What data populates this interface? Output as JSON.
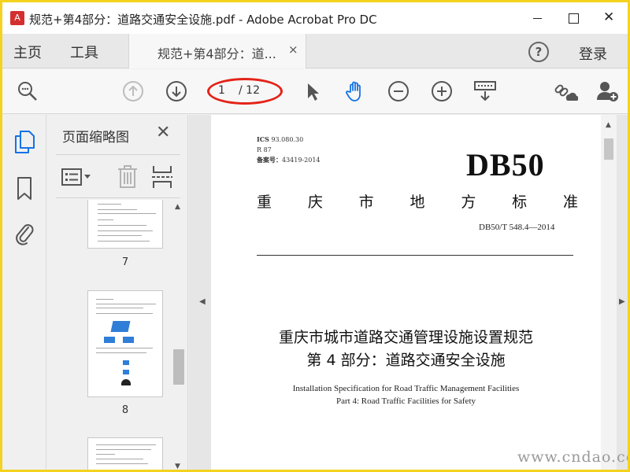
{
  "window": {
    "title": "规范+第4部分：道路交通安全设施.pdf - Adobe Acrobat Pro DC",
    "min_icon": "minimize-icon",
    "max_icon": "maximize-icon",
    "close_glyph": "✕"
  },
  "menu": {
    "home": "主页",
    "tools": "工具",
    "doc_tab": "规范+第4部分：道...",
    "doc_tab_close": "×",
    "help_glyph": "?",
    "login": "登录"
  },
  "toolbar": {
    "zoom_icon": "search-zoom-icon",
    "prev_icon": "arrow-up-circle-icon",
    "next_icon": "arrow-down-circle-icon",
    "page_current": "1",
    "page_total": "/ 12",
    "select_icon": "cursor-icon",
    "hand_icon": "hand-icon",
    "zoom_out_icon": "minus-circle-icon",
    "zoom_in_icon": "plus-circle-icon",
    "fit_icon": "keyboard-down-icon",
    "share_link_icon": "link-cloud-icon",
    "add_user_icon": "add-user-icon",
    "accent_color": "#e42319",
    "hand_active_color": "#1473e6"
  },
  "rail": {
    "pages_icon": "page-thumbnails-icon",
    "bookmark_icon": "bookmark-icon",
    "attachment_icon": "paperclip-icon"
  },
  "thumbnails": {
    "title": "页面缩略图",
    "close_glyph": "✕",
    "options_icon": "thumbnail-options-icon",
    "delete_icon": "trash-icon",
    "extract_icon": "extract-page-icon",
    "pages": [
      {
        "number": "7"
      },
      {
        "number": "8"
      }
    ]
  },
  "document": {
    "ics": "ICS",
    "ics_code": "93.080.30",
    "r_code": "R 87",
    "record_label": "备案号：",
    "record_value": "43419-2014",
    "std_code": "DB50",
    "std_type": [
      "重",
      "庆",
      "市",
      "地",
      "方",
      "标",
      "准"
    ],
    "std_number": "DB50/T 548.4—2014",
    "title_cn_1": "重庆市城市道路交通管理设施设置规范",
    "title_cn_2": "第 4 部分：道路交通安全设施",
    "title_en_1": "Installation Specification for Road Traffic Management Facilities",
    "title_en_2": "Part 4: Road Traffic Facilities for Safety"
  },
  "watermark": "www.cndao.com"
}
